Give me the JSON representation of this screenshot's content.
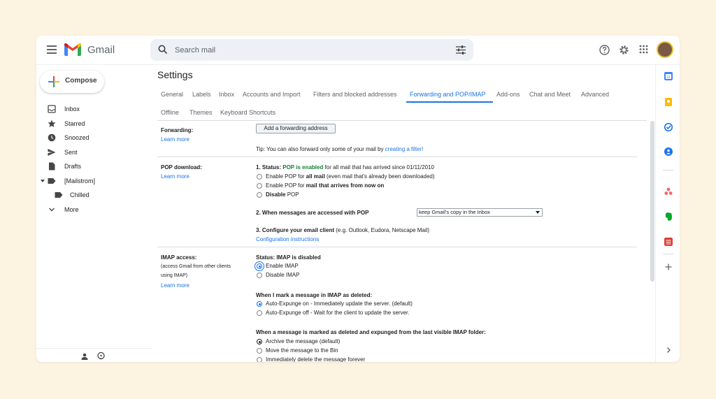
{
  "app": {
    "brand": "Gmail"
  },
  "search": {
    "placeholder": "Search mail"
  },
  "compose": {
    "label": "Compose"
  },
  "sidebar": {
    "items": [
      {
        "label": "Inbox",
        "icon": "inbox-icon"
      },
      {
        "label": "Starred",
        "icon": "star-icon"
      },
      {
        "label": "Snoozed",
        "icon": "clock-icon"
      },
      {
        "label": "Sent",
        "icon": "send-icon"
      },
      {
        "label": "Drafts",
        "icon": "draft-icon"
      },
      {
        "label": "[Mailstrom]",
        "icon": "label-icon"
      },
      {
        "label": "Chilled",
        "icon": "label-icon"
      },
      {
        "label": "More",
        "icon": "chevron-down-icon"
      }
    ]
  },
  "page": {
    "title": "Settings"
  },
  "tabs": [
    "General",
    "Labels",
    "Inbox",
    "Accounts and Import",
    "Filters and blocked addresses",
    "Forwarding and POP/IMAP",
    "Add-ons",
    "Chat and Meet",
    "Advanced",
    "Offline",
    "Themes",
    "Keyboard Shortcuts"
  ],
  "active_tab": "Forwarding and POP/IMAP",
  "forwarding": {
    "label": "Forwarding:",
    "learn_more": "Learn more",
    "button": "Add a forwarding address",
    "tip_prefix": "Tip: You can also forward only some of your mail by ",
    "tip_link": "creating a filter!"
  },
  "pop": {
    "label": "POP download:",
    "learn_more": "Learn more",
    "status_prefix": "1. Status: ",
    "status_value": "POP is enabled",
    "status_suffix": " for all mail that has arrived since 01/11/2010",
    "opt1_a": "Enable POP for ",
    "opt1_b": "all mail",
    "opt1_c": " (even mail that's already been downloaded)",
    "opt2_a": "Enable POP for ",
    "opt2_b": "mail that arrives from now on",
    "opt3_a": "Disable",
    "opt3_b": " POP",
    "q2": "2. When messages are accessed with POP",
    "q2_select": "keep Gmail's copy in the Inbox",
    "q3_a": "3. Configure your email client",
    "q3_b": " (e.g. Outlook, Eudora, Netscape Mail)",
    "config_link": "Configuration instructions"
  },
  "imap": {
    "label": "IMAP access:",
    "sub1": "(access Gmail from other clients",
    "sub2": "using IMAP)",
    "learn_more": "Learn more",
    "status": "Status: IMAP is disabled",
    "enable": "Enable IMAP",
    "disable": "Disable IMAP",
    "q_deleted": "When I mark a message in IMAP as deleted:",
    "expunge_on": "Auto-Expunge on - Immediately update the server. (default)",
    "expunge_off": "Auto-Expunge off - Wait for the client to update the server.",
    "q_expunged": "When a message is marked as deleted and expunged from the last visible IMAP folder:",
    "archive": "Archive the message (default)",
    "bin": "Move the message to the Bin",
    "delete": "Immediately delete the message forever"
  },
  "colors": {
    "accent": "#1a73e8",
    "pop_enabled": "#188038",
    "background": "#fdf3e1"
  }
}
